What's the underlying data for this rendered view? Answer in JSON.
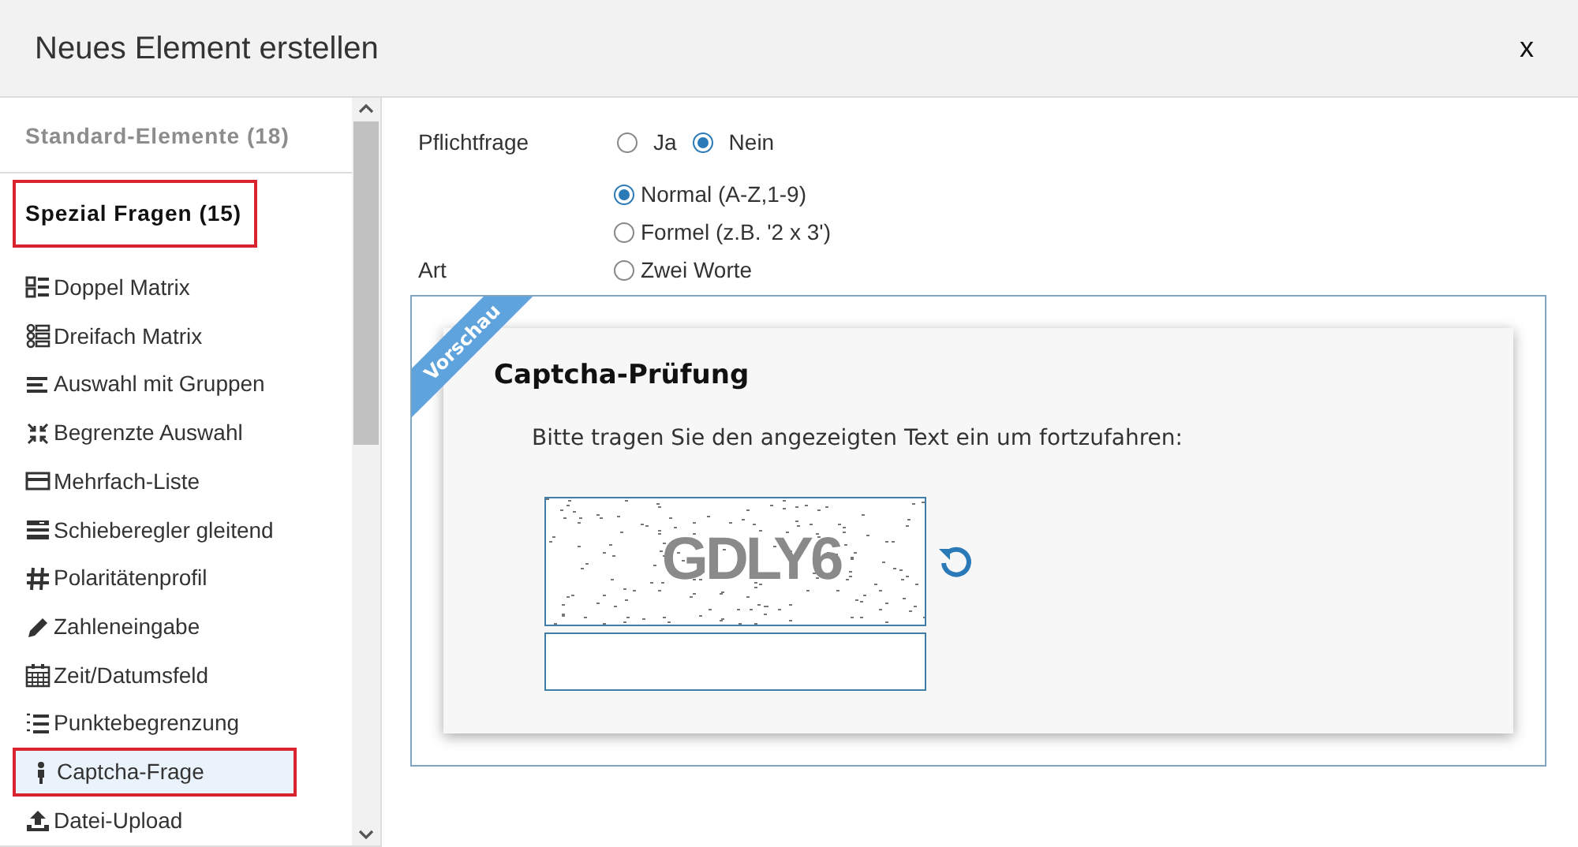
{
  "dialog": {
    "title": "Neues Element erstellen",
    "close": "x"
  },
  "sidebar": {
    "groups": [
      {
        "label": "Standard-Elemente (18)",
        "expanded": false,
        "highlighted": false
      },
      {
        "label": "Spezial Fragen (15)",
        "expanded": true,
        "highlighted": true
      }
    ],
    "items": [
      {
        "label": "Doppel Matrix",
        "kind": "double-grid",
        "selected": false,
        "highlighted": false
      },
      {
        "label": "Dreifach Matrix",
        "kind": "triple-grid",
        "selected": false,
        "highlighted": false
      },
      {
        "label": "Auswahl mit Gruppen",
        "kind": "lines",
        "selected": false,
        "highlighted": false
      },
      {
        "label": "Begrenzte Auswahl",
        "kind": "compress",
        "selected": false,
        "highlighted": false
      },
      {
        "label": "Mehrfach-Liste",
        "kind": "card",
        "selected": false,
        "highlighted": false
      },
      {
        "label": "Schieberegler gleitend",
        "kind": "sliders",
        "selected": false,
        "highlighted": false
      },
      {
        "label": "Polaritätenprofil",
        "kind": "hash",
        "selected": false,
        "highlighted": false
      },
      {
        "label": "Zahleneingabe",
        "kind": "pencil",
        "selected": false,
        "highlighted": false
      },
      {
        "label": "Zeit/Datumsfeld",
        "kind": "calendar",
        "selected": false,
        "highlighted": false
      },
      {
        "label": "Punktebegrenzung",
        "kind": "numbered-list",
        "selected": false,
        "highlighted": false
      },
      {
        "label": "Captcha-Frage",
        "kind": "person",
        "selected": true,
        "highlighted": true
      },
      {
        "label": "Datei-Upload",
        "kind": "upload",
        "selected": false,
        "highlighted": false
      }
    ]
  },
  "settings": [
    {
      "label": "Pflichtfrage",
      "kind": "inline",
      "options": [
        {
          "label": "Ja",
          "selected": false
        },
        {
          "label": "Nein",
          "selected": true
        }
      ]
    },
    {
      "label": "Art",
      "kind": "stacked",
      "options": [
        {
          "label": "Normal (A-Z,1-9)",
          "selected": true
        },
        {
          "label": "Formel (z.B. '2 x 3')",
          "selected": false
        },
        {
          "label": "Zwei Worte",
          "selected": false
        }
      ]
    }
  ],
  "preview": {
    "ribbon": "Vorschau",
    "title": "Captcha-Prüfung",
    "instruction": "Bitte tragen Sie den angezeigten Text ein um fortzufahren:",
    "captcha_text": "GDLY6"
  }
}
